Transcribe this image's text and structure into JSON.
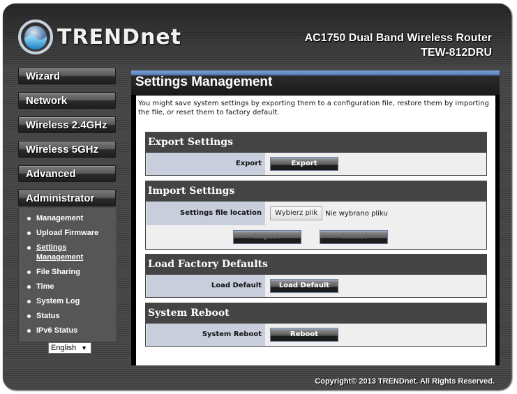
{
  "header": {
    "brand": "TRENDnet",
    "product_line": "AC1750 Dual Band Wireless Router",
    "model": "TEW-812DRU"
  },
  "sidebar": {
    "nav": [
      {
        "label": "Wizard"
      },
      {
        "label": "Network"
      },
      {
        "label": "Wireless 2.4GHz"
      },
      {
        "label": "Wireless 5GHz"
      },
      {
        "label": "Advanced"
      },
      {
        "label": "Administrator"
      }
    ],
    "submenu": [
      {
        "label": "Management",
        "active": false
      },
      {
        "label": "Upload Firmware",
        "active": false
      },
      {
        "label": "Settings Management",
        "active": true
      },
      {
        "label": "File Sharing",
        "active": false
      },
      {
        "label": "Time",
        "active": false
      },
      {
        "label": "System Log",
        "active": false
      },
      {
        "label": "Status",
        "active": false
      },
      {
        "label": "IPv6 Status",
        "active": false
      }
    ],
    "language": {
      "selected": "English",
      "icon": "triangle-down-icon"
    }
  },
  "main": {
    "title": "Settings Management",
    "description": "You might save system settings by exporting them to a configuration file, restore them by importing the file, or reset them to factory default.",
    "export": {
      "heading": "Export Settings",
      "label": "Export",
      "button": "Export"
    },
    "import": {
      "heading": "Import Settings",
      "label": "Settings file location",
      "file_button": "Wybierz plik",
      "file_status": "Nie wybrano pliku",
      "import_button": "Import",
      "cancel_button": "Cancel"
    },
    "factory": {
      "heading": "Load Factory Defaults",
      "label": "Load Default",
      "button": "Load Default"
    },
    "reboot": {
      "heading": "System Reboot",
      "label": "System Reboot",
      "button": "Reboot"
    }
  },
  "footer": {
    "copyright": "Copyright© 2013 TRENDnet. All Rights Reserved."
  },
  "colors": {
    "section_header": "#444444",
    "label_cell": "#c8cedc",
    "accent_blue": "#7fa3d8"
  }
}
